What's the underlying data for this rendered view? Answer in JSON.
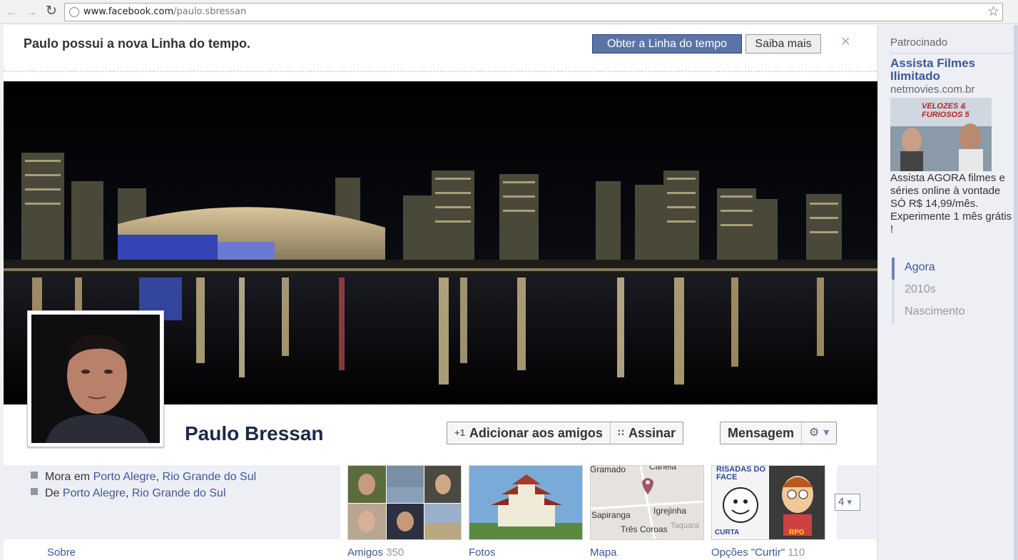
{
  "browser": {
    "url_host": "www.facebook.com",
    "url_path": "/paulo.sbressan",
    "back_icon": "left-arrow-icon",
    "forward_icon": "right-arrow-icon",
    "reload_icon": "reload-icon",
    "bookmark_icon": "star-icon"
  },
  "banner": {
    "text": "Paulo possui a nova Linha do tempo.",
    "primary_label": "Obter a Linha do tempo",
    "secondary_label": "Saiba mais",
    "close_label": "×"
  },
  "profile": {
    "name": "Paulo Bressan",
    "add_friend_label": "Adicionar aos amigos",
    "subscribe_label": "Assinar",
    "message_label": "Mensagem",
    "add_friend_icon": "+1",
    "subscribe_icon": "∷",
    "gear_icon": "⚙",
    "dropdown_icon": "▾"
  },
  "info": {
    "lives_prefix": "Mora em",
    "lives_city": "Porto Alegre",
    "lives_sep": ",",
    "lives_state": "Rio Grande do Sul",
    "from_prefix": "De",
    "from_city": "Porto Alegre",
    "from_sep": ",",
    "from_state": "Rio Grande do Sul",
    "about_label": "Sobre"
  },
  "tiles": {
    "friends_label": "Amigos",
    "friends_count": "350",
    "photos_label": "Fotos",
    "map_label": "Mapa",
    "map_places": [
      "Gramado",
      "Canela",
      "Sapiranga",
      "Igrejinha",
      "Três Coroas",
      "Taquara"
    ],
    "likes_label": "Opções \"Curtir\"",
    "likes_count": "110",
    "likes_logo_text": "RISADAS DO FACE",
    "likes_logo_text2": "CURTA",
    "likes_logo_text3": "RPG",
    "more_count": "4",
    "more_icon": "▾"
  },
  "sidebar": {
    "sponsored_label": "Patrocinado",
    "ad_title": "Assista Filmes Ilimitado",
    "ad_domain": "netmovies.com.br",
    "ad_image_text": "VELOZES & FURIOSOS 5",
    "ad_body": "Assista AGORA filmes e séries online à vontade SÓ R$ 14,99/mês. Experimente 1 mês grátis !",
    "timeline_items": [
      "Agora",
      "2010s",
      "Nascimento"
    ]
  }
}
